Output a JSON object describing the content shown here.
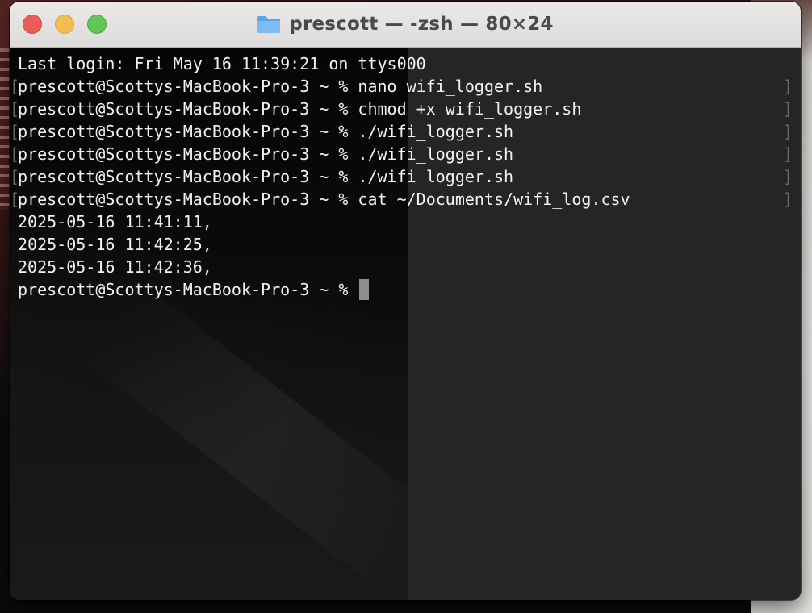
{
  "window": {
    "title": "prescott — -zsh — 80×24",
    "folder_icon": "folder-icon",
    "traffic_lights": {
      "close_color": "#ee5c56",
      "minimize_color": "#f4bd4f",
      "zoom_color": "#61c654"
    }
  },
  "terminal": {
    "text_color": "#f2f2f2",
    "background_color": "#1a1a1a",
    "lines": [
      {
        "text": "Last login: Fri May 16 11:39:21 on ttys000",
        "marked": false
      },
      {
        "text": "prescott@Scottys-MacBook-Pro-3 ~ % nano wifi_logger.sh",
        "marked": true
      },
      {
        "text": "prescott@Scottys-MacBook-Pro-3 ~ % chmod +x wifi_logger.sh",
        "marked": true
      },
      {
        "text": "prescott@Scottys-MacBook-Pro-3 ~ % ./wifi_logger.sh",
        "marked": true
      },
      {
        "text": "prescott@Scottys-MacBook-Pro-3 ~ % ./wifi_logger.sh",
        "marked": true
      },
      {
        "text": "prescott@Scottys-MacBook-Pro-3 ~ % ./wifi_logger.sh",
        "marked": true
      },
      {
        "text": "prescott@Scottys-MacBook-Pro-3 ~ % cat ~/Documents/wifi_log.csv",
        "marked": true
      },
      {
        "text": "2025-05-16 11:41:11,",
        "marked": false
      },
      {
        "text": "2025-05-16 11:42:25,",
        "marked": false
      },
      {
        "text": "2025-05-16 11:42:36,",
        "marked": false
      }
    ],
    "prompt": "prescott@Scottys-MacBook-Pro-3 ~ % "
  }
}
